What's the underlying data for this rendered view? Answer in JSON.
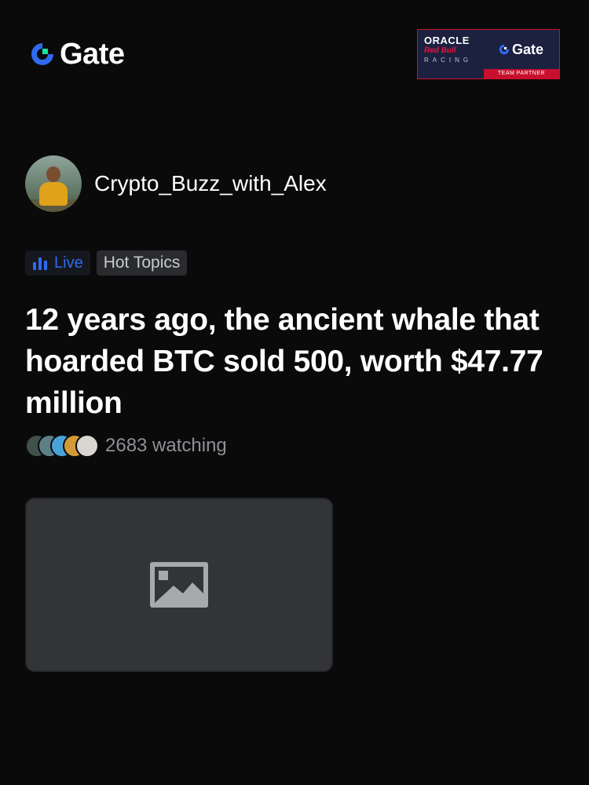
{
  "header": {
    "brand": "Gate",
    "partner": {
      "oracle": "ORACLE",
      "redbull": "Red Bull",
      "racing": "RACING",
      "brand": "Gate",
      "label": "TEAM PARTNER"
    }
  },
  "author": {
    "name": "Crypto_Buzz_with_Alex"
  },
  "tags": {
    "live": "Live",
    "hot": "Hot Topics"
  },
  "post": {
    "title": "12 years ago, the ancient whale that hoarded BTC sold 500, worth $47.77 million"
  },
  "watching": {
    "text": "2683 watching"
  },
  "colors": {
    "background": "#0a0a0b",
    "brand_blue": "#2e6bf0",
    "brand_green": "#17e3a0",
    "partner_red": "#c8102e"
  },
  "icons": [
    "gate-logo-icon",
    "live-bars-icon",
    "image-placeholder-icon"
  ]
}
